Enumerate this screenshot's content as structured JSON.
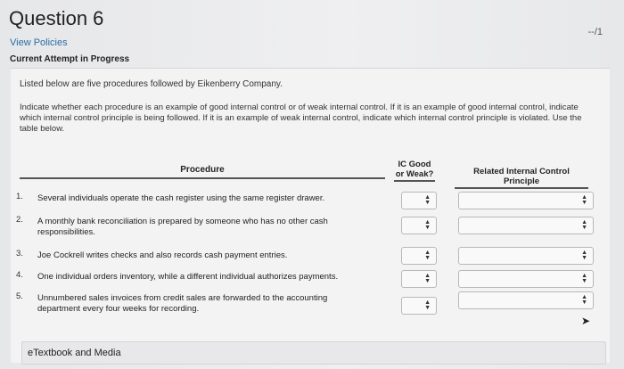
{
  "header": {
    "title": "Question 6",
    "score": "--/1",
    "view_policies": "View Policies",
    "attempt_status": "Current Attempt in Progress"
  },
  "question": {
    "intro": "Listed below are five procedures followed by Eikenberry Company.",
    "instructions": "Indicate whether each procedure is an example of good internal control or of weak internal control. If it is an example of good internal control, indicate which internal control principle is being followed. If it is an example of weak internal control, indicate which internal control principle is violated. Use the table below."
  },
  "table": {
    "headers": {
      "procedure": "Procedure",
      "ic": "IC Good or Weak?",
      "principle": "Related Internal Control Principle"
    },
    "rows": [
      {
        "num": "1.",
        "text": "Several individuals operate the cash register using the same register drawer."
      },
      {
        "num": "2.",
        "text": "A monthly bank reconciliation is prepared by someone who has no other cash responsibilities."
      },
      {
        "num": "3.",
        "text": "Joe Cockrell writes checks and also records cash payment entries."
      },
      {
        "num": "4.",
        "text": "One individual orders inventory, while a different individual authorizes payments."
      },
      {
        "num": "5.",
        "text": "Unnumbered sales invoices from credit sales are forwarded to the accounting department every four weeks for recording."
      }
    ]
  },
  "footer": {
    "etextbook": "eTextbook and Media"
  },
  "icons": {
    "select_chevron": "up-down-chevron-icon",
    "cursor": "pointer-cursor-icon"
  }
}
